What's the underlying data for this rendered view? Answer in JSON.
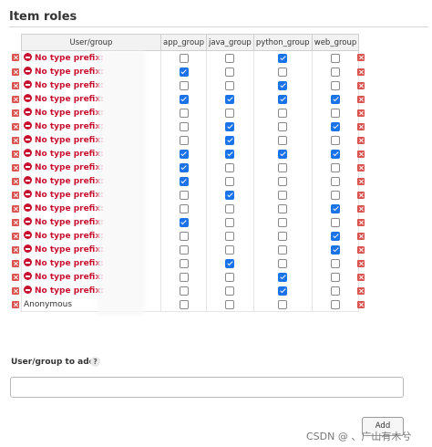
{
  "section": {
    "title": "Item roles"
  },
  "table": {
    "headers": [
      "User/group",
      "app_group",
      "java_group",
      "python_group",
      "web_group"
    ],
    "prefix": "No type prefix:",
    "rows": [
      {
        "name": "",
        "checks": [
          false,
          false,
          true,
          false
        ]
      },
      {
        "name": "",
        "checks": [
          true,
          false,
          false,
          false
        ]
      },
      {
        "name": "",
        "checks": [
          false,
          false,
          true,
          false
        ]
      },
      {
        "name": "",
        "checks": [
          true,
          true,
          true,
          true
        ]
      },
      {
        "name": "",
        "checks": [
          false,
          false,
          false,
          false
        ]
      },
      {
        "name": "",
        "checks": [
          false,
          true,
          false,
          true
        ]
      },
      {
        "name": "",
        "checks": [
          false,
          true,
          false,
          false
        ]
      },
      {
        "name": "",
        "checks": [
          true,
          true,
          true,
          true
        ]
      },
      {
        "name": "",
        "checks": [
          true,
          false,
          false,
          false
        ]
      },
      {
        "name": "",
        "checks": [
          true,
          false,
          false,
          false
        ]
      },
      {
        "name": "",
        "checks": [
          false,
          true,
          false,
          false
        ]
      },
      {
        "name": "",
        "checks": [
          false,
          false,
          false,
          true
        ]
      },
      {
        "name": "",
        "checks": [
          true,
          false,
          false,
          false
        ]
      },
      {
        "name": "",
        "checks": [
          false,
          false,
          false,
          true
        ]
      },
      {
        "name": "",
        "checks": [
          false,
          false,
          false,
          true
        ]
      },
      {
        "name": "",
        "checks": [
          false,
          true,
          false,
          false
        ]
      },
      {
        "name": "",
        "checks": [
          false,
          false,
          true,
          false
        ]
      },
      {
        "name": "",
        "checks": [
          false,
          false,
          true,
          false
        ]
      }
    ],
    "anonymous": {
      "name": "Anonymous",
      "checks": [
        false,
        false,
        false,
        false
      ]
    }
  },
  "add_user": {
    "label": "User/group to add",
    "help": "?",
    "input_value": "",
    "button_label": "Add"
  },
  "watermark": "CSDN @ 、广山有木兮",
  "colors": {
    "error_red": "#c8102e",
    "checkbox_blue": "#1a73e8",
    "delete_red": "#d9534f"
  }
}
